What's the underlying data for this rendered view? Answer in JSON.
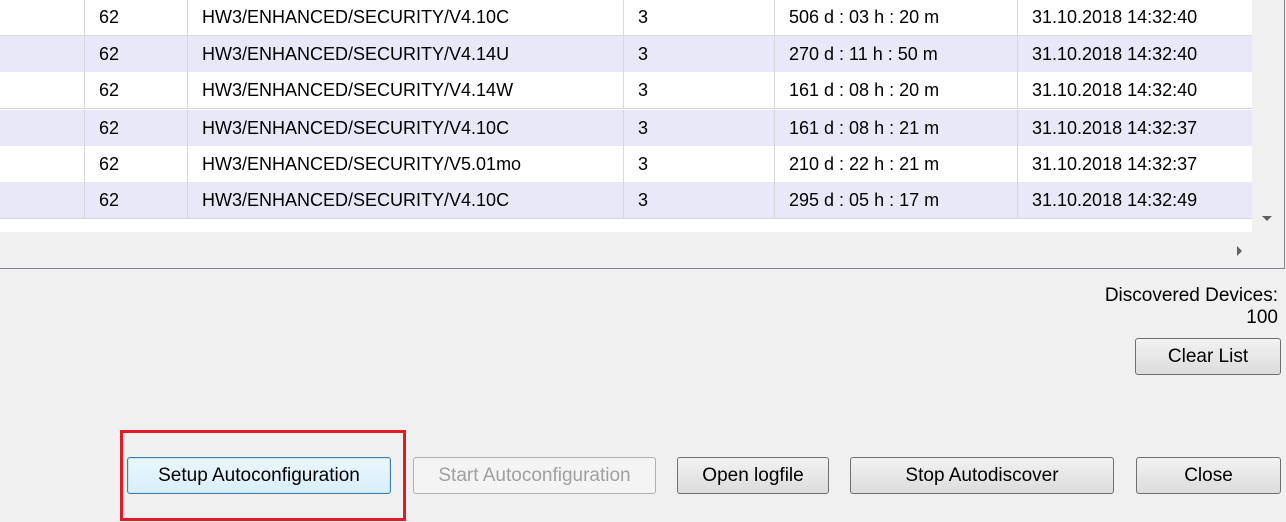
{
  "grid": {
    "rows": [
      {
        "cells": [
          "",
          "62",
          "HW3/ENHANCED/SECURITY/V4.10C",
          "3",
          "506 d : 03 h : 20 m",
          "31.10.2018 14:32:40"
        ]
      },
      {
        "cells": [
          "",
          "62",
          "HW3/ENHANCED/SECURITY/V4.14U",
          "3",
          "270 d : 11 h : 50 m",
          "31.10.2018 14:32:40"
        ]
      },
      {
        "cells": [
          "",
          "62",
          "HW3/ENHANCED/SECURITY/V4.14W",
          "3",
          "161 d : 08 h : 20 m",
          "31.10.2018 14:32:40"
        ]
      },
      {
        "cells": [
          "",
          "62",
          "HW3/ENHANCED/SECURITY/V4.10C",
          "3",
          "161 d : 08 h : 21 m",
          "31.10.2018 14:32:37"
        ]
      },
      {
        "cells": [
          "",
          "62",
          "HW3/ENHANCED/SECURITY/V5.01mo",
          "3",
          "210 d : 22 h : 21 m",
          "31.10.2018 14:32:37"
        ]
      },
      {
        "cells": [
          "",
          "62",
          "HW3/ENHANCED/SECURITY/V4.10C",
          "3",
          "295 d : 05 h : 17 m",
          "31.10.2018 14:32:49"
        ]
      }
    ]
  },
  "status": {
    "discovered_label": "Discovered Devices:",
    "discovered_count": "100"
  },
  "buttons": {
    "clear_list": "Clear List",
    "setup_autoconfig": "Setup Autoconfiguration",
    "start_autoconfig": "Start Autoconfiguration",
    "open_logfile": "Open logfile",
    "stop_autodiscover": "Stop Autodiscover",
    "close": "Close"
  },
  "colors": {
    "row_alt": "#e8e8f8",
    "highlight": "#e01b24"
  }
}
